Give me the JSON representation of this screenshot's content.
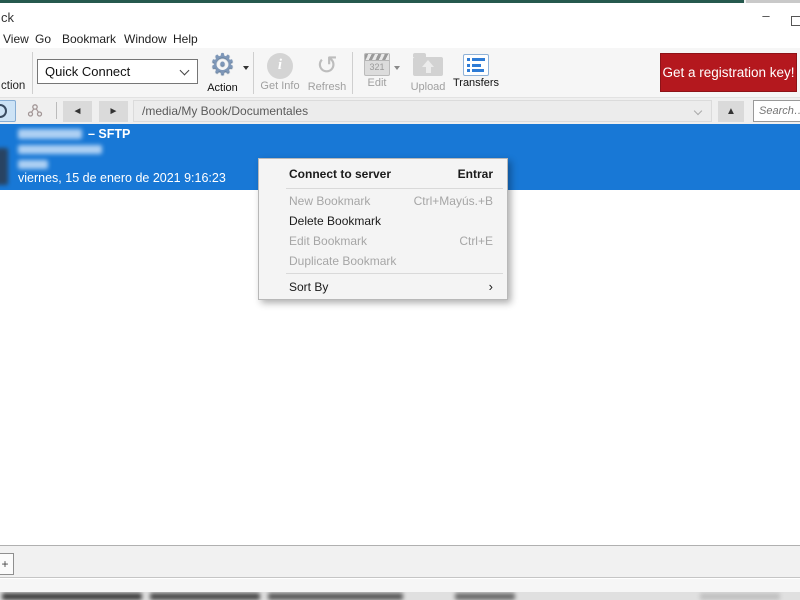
{
  "window": {
    "title_fragment": "ck",
    "minimize_glyph": "–"
  },
  "menu_bar": {
    "items": [
      "View",
      "Go",
      "Bookmark",
      "Window",
      "Help"
    ]
  },
  "toolbar": {
    "open_connection_fragment": "ction",
    "quick_connect_value": "Quick Connect",
    "action_label": "Action",
    "get_info_label": "Get Info",
    "refresh_label": "Refresh",
    "edit_label": "Edit",
    "edit_icon_text": "321",
    "upload_label": "Upload",
    "transfers_label": "Transfers",
    "registration_label": "Get a registration key!",
    "registration_color": "#b4181e"
  },
  "nav": {
    "path": "/media/My Book/Documentales",
    "search_placeholder": "Search…"
  },
  "bookmark_row": {
    "protocol_suffix": "– SFTP",
    "date": "viernes, 15 de enero de 2021 9:16:23",
    "selection_color": "#1878d6"
  },
  "context_menu": {
    "items": [
      {
        "label": "Connect to server",
        "shortcut": "Entrar",
        "enabled": true
      },
      {
        "label": "New Bookmark",
        "shortcut": "Ctrl+Mayús.+B",
        "enabled": false
      },
      {
        "label": "Delete Bookmark",
        "shortcut": "",
        "enabled": true
      },
      {
        "label": "Edit Bookmark",
        "shortcut": "Ctrl+E",
        "enabled": false
      },
      {
        "label": "Duplicate Bookmark",
        "shortcut": "",
        "enabled": false
      },
      {
        "label": "Sort By",
        "shortcut": "›",
        "enabled": true
      }
    ]
  },
  "icons": {
    "gear": "⚙",
    "info": "i",
    "refresh": "↺",
    "back": "◄",
    "forward": "►",
    "up": "▲",
    "add": "+"
  }
}
